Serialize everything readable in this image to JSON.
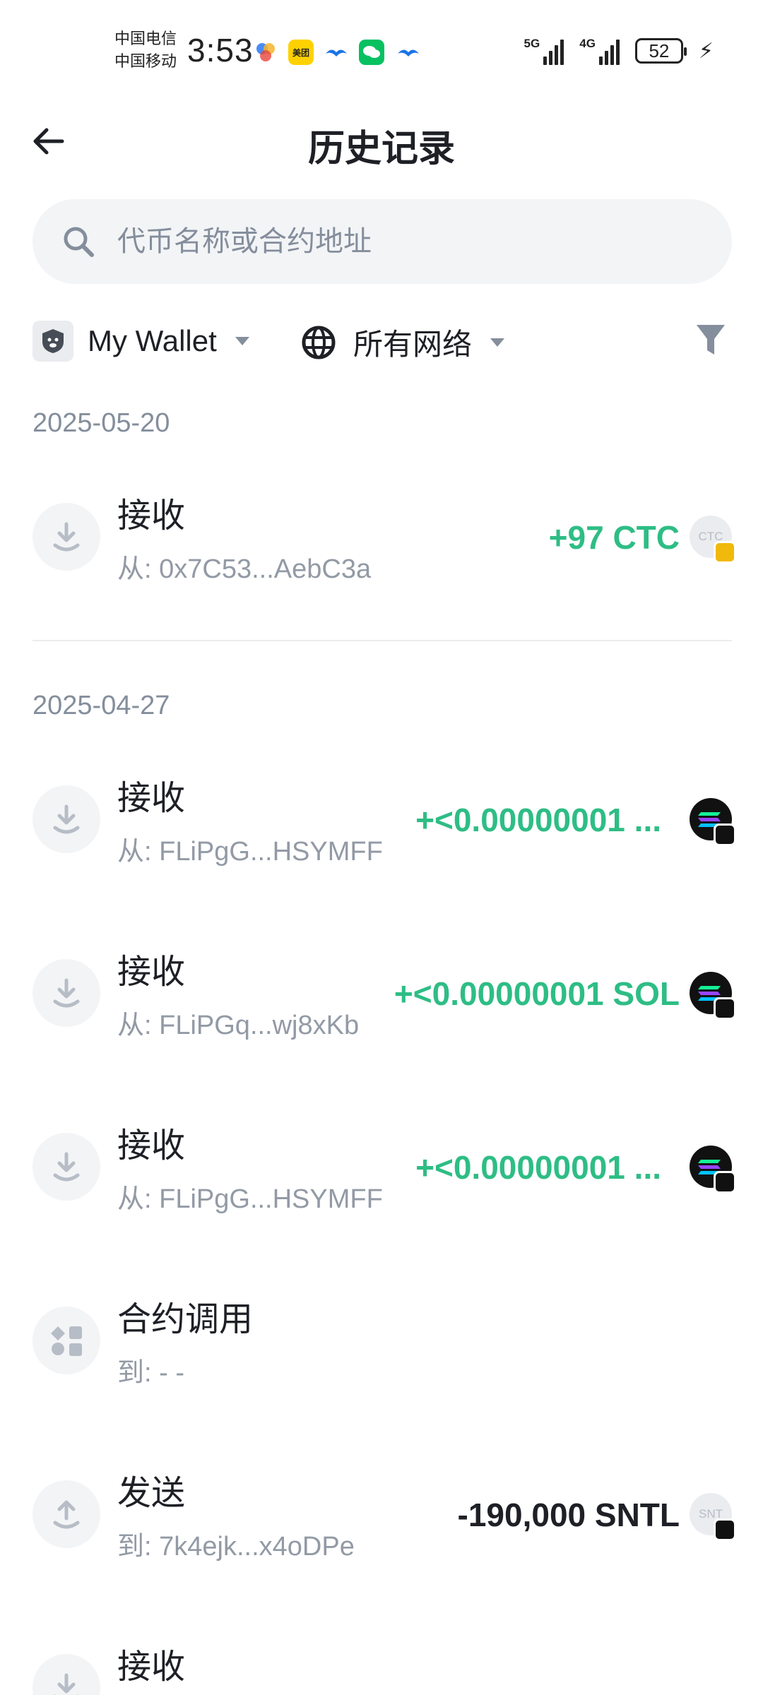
{
  "status_bar": {
    "carrier_1": "中国电信",
    "carrier_2": "中国移动",
    "time": "3:53",
    "signal_1_label": "5G",
    "signal_2_label": "4G",
    "battery": "52",
    "app_icons": [
      "colorful-pinwheel-icon",
      "meituan-icon",
      "bird-icon",
      "wechat-icon",
      "bird-icon"
    ],
    "meituan_label": "美团"
  },
  "header": {
    "title": "历史记录"
  },
  "search": {
    "placeholder": "代币名称或合约地址"
  },
  "filters": {
    "wallet": "My Wallet",
    "network": "所有网络"
  },
  "groups": [
    {
      "date": "2025-05-20",
      "transactions": [
        {
          "type": "接收",
          "address": "从: 0x7C53...AebC3a",
          "amount": "+97 CTC",
          "direction": "in",
          "token": "CTC",
          "icon": "receive-icon"
        }
      ]
    },
    {
      "date": "2025-04-27",
      "transactions": [
        {
          "type": "接收",
          "address": "从: FLiPgG...HSYMFF",
          "amount": "+<0.00000001 ...",
          "direction": "in",
          "token": "SOL",
          "icon": "receive-icon"
        },
        {
          "type": "接收",
          "address": "从: FLiPGq...wj8xKb",
          "amount": "+<0.00000001 SOL",
          "direction": "in",
          "token": "SOL",
          "icon": "receive-icon"
        },
        {
          "type": "接收",
          "address": "从: FLiPgG...HSYMFF",
          "amount": "+<0.00000001 ...",
          "direction": "in",
          "token": "SOL",
          "icon": "receive-icon"
        },
        {
          "type": "合约调用",
          "address": "到: - -",
          "amount": "",
          "direction": "none",
          "token": "",
          "icon": "contract-call-icon"
        },
        {
          "type": "发送",
          "address": "到: 7k4ejk...x4oDPe",
          "amount": "-190,000 SNTL",
          "direction": "out",
          "token": "SNTL",
          "icon": "send-icon"
        },
        {
          "type": "接收",
          "address": "",
          "amount": "",
          "direction": "in",
          "token": "",
          "icon": "receive-icon"
        }
      ]
    }
  ],
  "colors": {
    "positive": "#2ebd85",
    "text_primary": "#1e2026",
    "text_secondary": "#848e9c"
  }
}
